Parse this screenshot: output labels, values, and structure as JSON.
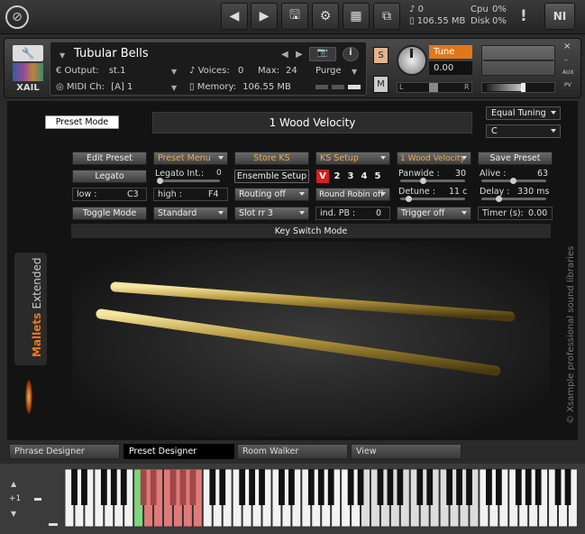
{
  "topbar": {
    "voices_count": "0",
    "memory": "106.55 MB",
    "cpu_label": "Cpu",
    "cpu_value": "0%",
    "disk_label": "Disk",
    "disk_value": "0%",
    "ni_logo": "NI"
  },
  "instrument": {
    "logo_text": "XAIL",
    "name": "Tubular Bells",
    "output_label": "Output:",
    "output_value": "st.1",
    "voices_label": "Voices:",
    "voices_value": "0",
    "max_label": "Max:",
    "max_value": "24",
    "purge_label": "Purge",
    "midi_label": "MIDI Ch:",
    "midi_value": "[A]  1",
    "memory_label": "Memory:",
    "memory_value": "106.55 MB",
    "solo_label": "S",
    "mute_label": "M",
    "tune_label": "Tune",
    "tune_value": "0.00",
    "pan_left": "L",
    "pan_right": "R",
    "aux_label": "AUX",
    "pv_label": "PV"
  },
  "panel": {
    "preset_mode": "Preset Mode",
    "preset_name": "1 Wood Velocity",
    "tuning": "Equal Tuning",
    "key": "C",
    "edit_preset": "Edit Preset",
    "preset_menu": "Preset Menu",
    "store_ks": "Store KS",
    "ks_setup": "KS Setup",
    "velocity_menu": "1 Wood Velocity",
    "save_preset": "Save Preset",
    "legato": "Legato",
    "legato_int_label": "Legato Int.:",
    "legato_int_value": "0",
    "ensemble_setup": "Ensemble Setup",
    "slot_v": "V",
    "slot_2": "2",
    "slot_3": "3",
    "slot_4": "4",
    "slot_5": "5",
    "panwide_label": "Panwide :",
    "panwide_value": "30",
    "alive_label": "Alive :",
    "alive_value": "63",
    "low_label": "low :",
    "low_value": "C3",
    "high_label": "high :",
    "high_value": "F4",
    "routing": "Routing off",
    "round_robin": "Round Robin off",
    "detune_label": "Detune :",
    "detune_value": "11 c",
    "delay_label": "Delay :",
    "delay_value": "330 ms",
    "toggle_mode": "Toggle Mode",
    "standard": "Standard",
    "slot_rr": "Slot rr 3",
    "ind_pb_label": "ind. PB :",
    "ind_pb_value": "0",
    "trigger": "Trigger off",
    "timer_label": "Timer (s):",
    "timer_value": "0.00",
    "keyswitch_mode": "Key Switch Mode",
    "side_title_a": "Mallets",
    "side_title_b": "Extended",
    "copyright": "© Xsample professional sound libraries"
  },
  "tabs": [
    "Phrase Designer",
    "Preset Designer",
    "Room Walker",
    "View"
  ],
  "keyboard": {
    "octave_label": "+1"
  },
  "colors": {
    "accent_orange": "#f2a850",
    "keyboard_red": "#e07a7a",
    "keyboard_green": "#7fd67f"
  }
}
